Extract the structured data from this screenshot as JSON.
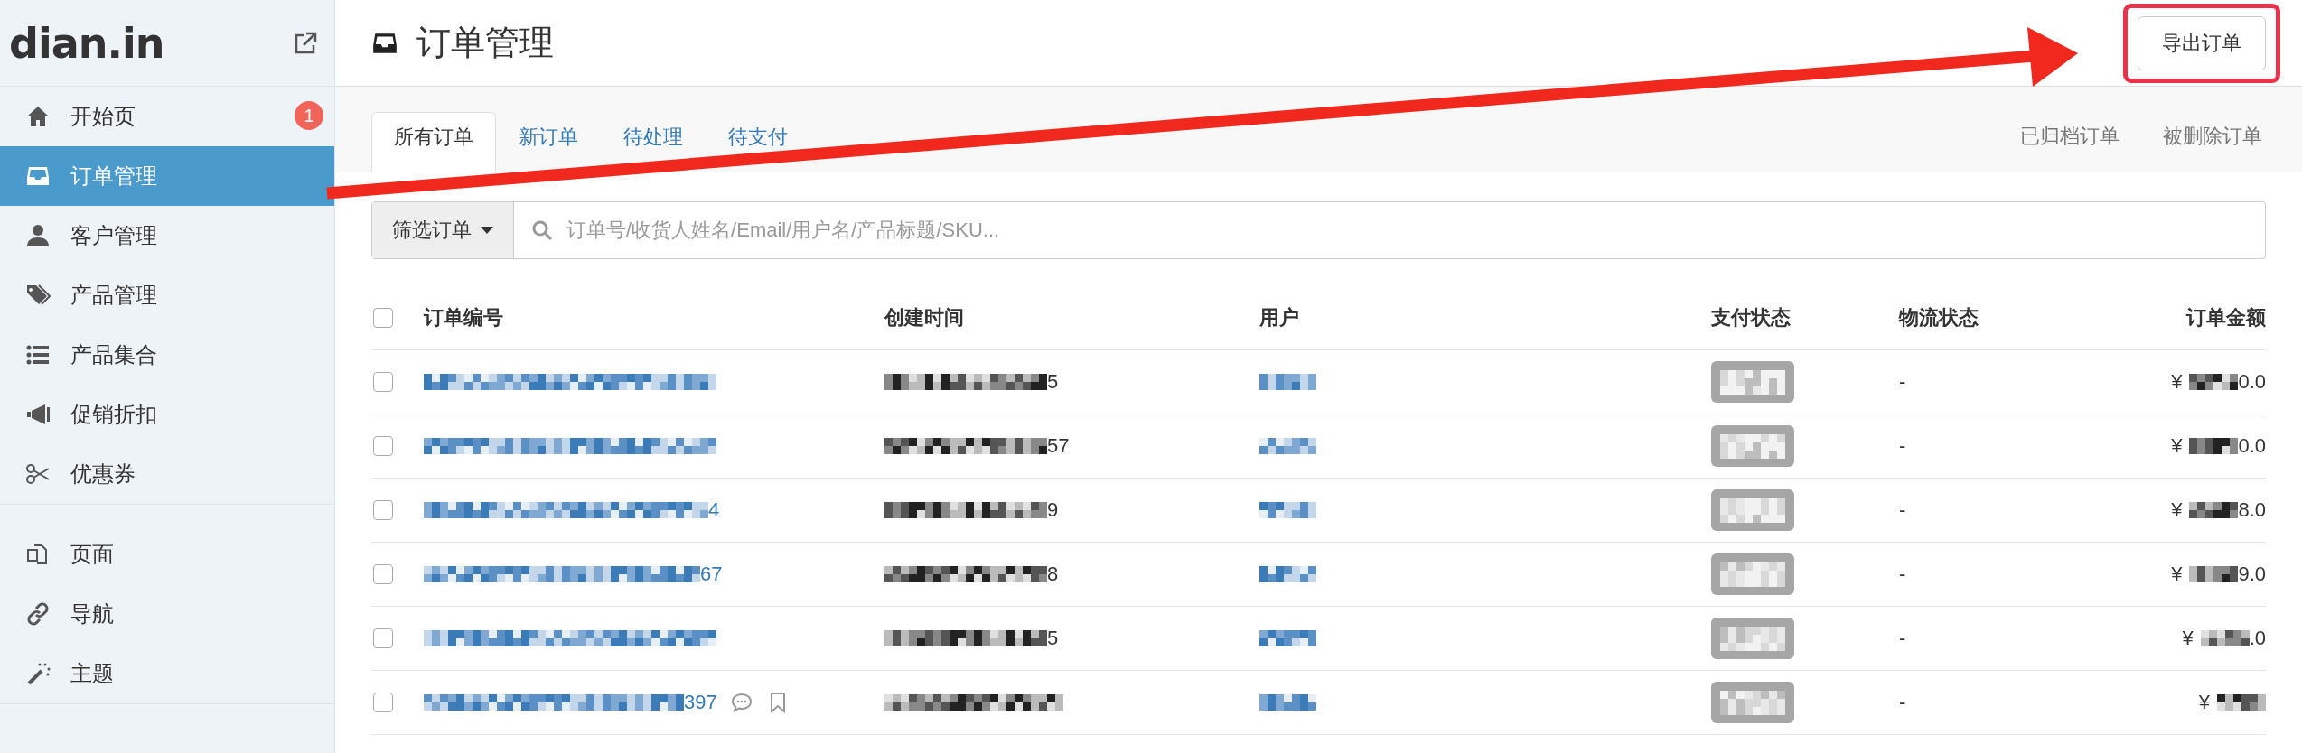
{
  "sidebar": {
    "logo": "dian.in",
    "sections": [
      [
        {
          "label": "开始页",
          "selected": false,
          "badge": "1"
        },
        {
          "label": "订单管理",
          "selected": true
        },
        {
          "label": "客户管理",
          "selected": false
        },
        {
          "label": "产品管理",
          "selected": false
        },
        {
          "label": "产品集合",
          "selected": false
        },
        {
          "label": "促销折扣",
          "selected": false
        },
        {
          "label": "优惠券",
          "selected": false
        }
      ],
      [
        {
          "label": "页面",
          "selected": false
        },
        {
          "label": "导航",
          "selected": false
        },
        {
          "label": "主题",
          "selected": false
        }
      ]
    ]
  },
  "header": {
    "title": "订单管理",
    "export_button": "导出订单"
  },
  "tabs": [
    {
      "label": "所有订单",
      "selected": true
    },
    {
      "label": "新订单",
      "selected": false
    },
    {
      "label": "待处理",
      "selected": false
    },
    {
      "label": "待支付",
      "selected": false
    }
  ],
  "side_tabs": [
    "已归档订单",
    "被删除订单"
  ],
  "filter": {
    "button": "筛选订单",
    "placeholder": "订单号/收货人姓名/Email/用户名/产品标题/SKU..."
  },
  "table": {
    "columns": [
      "订单编号",
      "创建时间",
      "用户",
      "支付状态",
      "物流状态",
      "订单金额"
    ],
    "select_all": {
      "checked": false
    },
    "rows": [
      {
        "checked": false,
        "created_tail": "5",
        "payment_redacted": true,
        "logistics": "-",
        "currency": "¥",
        "amount_tail": "0.0"
      },
      {
        "checked": false,
        "created_tail": "57",
        "payment_redacted": true,
        "logistics": "-",
        "currency": "¥",
        "amount_tail": "0.0"
      },
      {
        "checked": false,
        "order_tail": "4",
        "created_tail": "9",
        "payment_redacted": true,
        "logistics": "-",
        "currency": "¥",
        "amount_tail": "8.0"
      },
      {
        "checked": false,
        "order_tail": "67",
        "created_tail": "8",
        "payment_redacted": true,
        "logistics": "-",
        "currency": "¥",
        "amount_tail": "9.0"
      },
      {
        "checked": false,
        "created_tail": "5",
        "payment_redacted": true,
        "logistics": "-",
        "currency": "¥",
        "amount_tail": ".0"
      },
      {
        "checked": false,
        "order_tail": "397",
        "comment": true,
        "bookmark": true,
        "payment_redacted": true,
        "logistics": "-",
        "currency": "¥"
      }
    ]
  },
  "annotations": {
    "arrow": true,
    "highlight_box": true
  }
}
